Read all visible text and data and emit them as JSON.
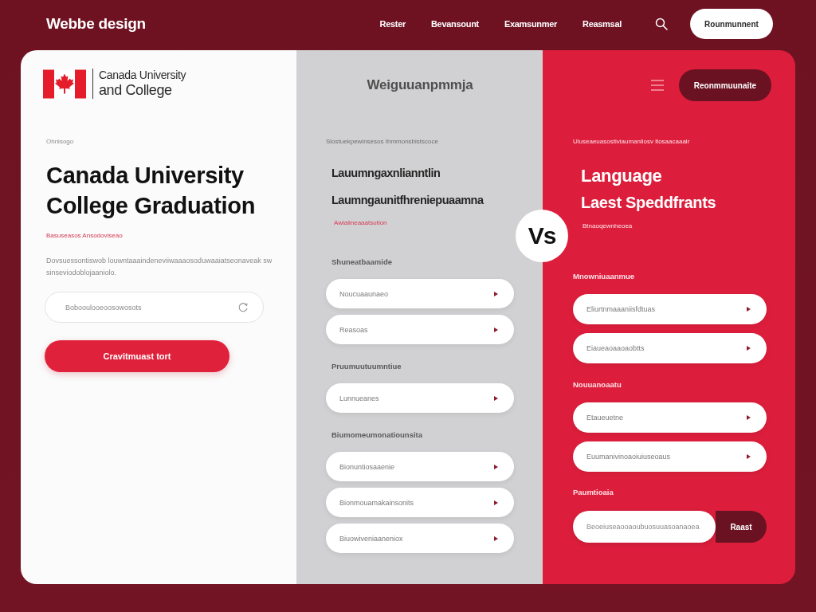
{
  "header": {
    "brand": "Webbe design",
    "nav": [
      "Rester",
      "Bevansount",
      "Examsunmer",
      "Reasmsal"
    ],
    "cta": "Rounmunnent"
  },
  "left": {
    "logo": {
      "top": "Canada University",
      "bottom": "and College"
    },
    "eyebrow": "Ohnisogo",
    "title": "Canada University College Graduation",
    "tagline": "Basuseasos Ansodoviseao",
    "description": "Dovsuessontiswob louwntaaaindeneviiwaaaosoduwaaiatseonaveak swsinseviodoblojaaniolo.",
    "search": {
      "placeholder": "Bobooulooeoosowosots"
    },
    "button": "Cravitmuast tort"
  },
  "middle": {
    "title": "Weiguuanpmmja",
    "eyebrow": "Slostuekpewinsesos Ihmmonsbistscoce",
    "headings": [
      "Lauumngaxnlianntlin",
      "Laumngaunitfhreniepuaamna"
    ],
    "tagline": "Awiaiineaaatsution",
    "groups": [
      {
        "label": "Shuneatbaamide",
        "items": [
          "Noucuaaunaeo",
          "Reasoas"
        ]
      },
      {
        "label": "Pruumuutuumntiue",
        "items": [
          "Lunnueanes"
        ]
      },
      {
        "label": "Biumomeumonatiounsita",
        "items": [
          "Bionuntiosaaenie",
          "Bionmouamakainsonits",
          "Biuowiveniaaneniox"
        ]
      }
    ]
  },
  "vs_badge": "Vs",
  "right": {
    "cta": "Reonmmuunaite",
    "eyebrow": "Uluseaeuasostiviaumanliosv ltosaacaaalr",
    "headings": [
      "Language",
      "Laest Speddfrants"
    ],
    "tagline": "Btnaoqewnheoea",
    "groups": [
      {
        "label": "Mnowniuaanmue",
        "items": [
          "Eliurtnmaaaniisfdtuas",
          "Eiaueaoaaoaobtts"
        ]
      },
      {
        "label": "Nouuanoaatu",
        "items": [
          "Etaueuetne",
          "Euumanivinoaoiuiuseoaus"
        ]
      }
    ],
    "subscribe": {
      "label": "Paumtioaia",
      "placeholder": "Beoeiuseaooaoubuosuuasoanaoea",
      "button": "Raast"
    }
  }
}
